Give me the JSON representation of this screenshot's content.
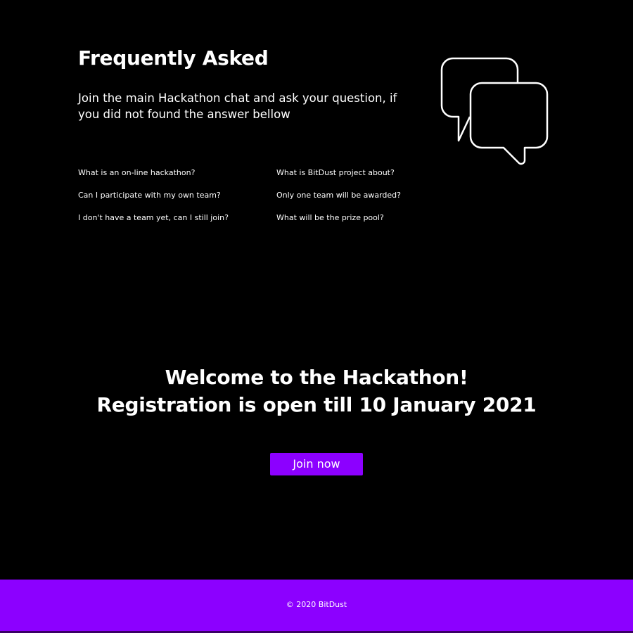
{
  "faq": {
    "title": "Frequently Asked",
    "description": "Join the main Hackathon chat and ask your question, if you did not found the answer bellow",
    "icon": "chat-bubbles-icon",
    "questions": [
      "What is an on-line hackathon?",
      "What is BitDust project about?",
      "Can I participate with my own team?",
      "Only one team will be awarded?",
      "I don't have a team yet, can I still join?",
      "What will be the prize pool?"
    ]
  },
  "hero": {
    "line1": "Welcome to the Hackathon!",
    "line2": "Registration is open till 10 January 2021",
    "join_label": "Join now"
  },
  "footer": {
    "copyright": "© 2020 BitDust"
  },
  "colors": {
    "background": "#000000",
    "accent": "#8c00ff",
    "text": "#ffffff"
  }
}
